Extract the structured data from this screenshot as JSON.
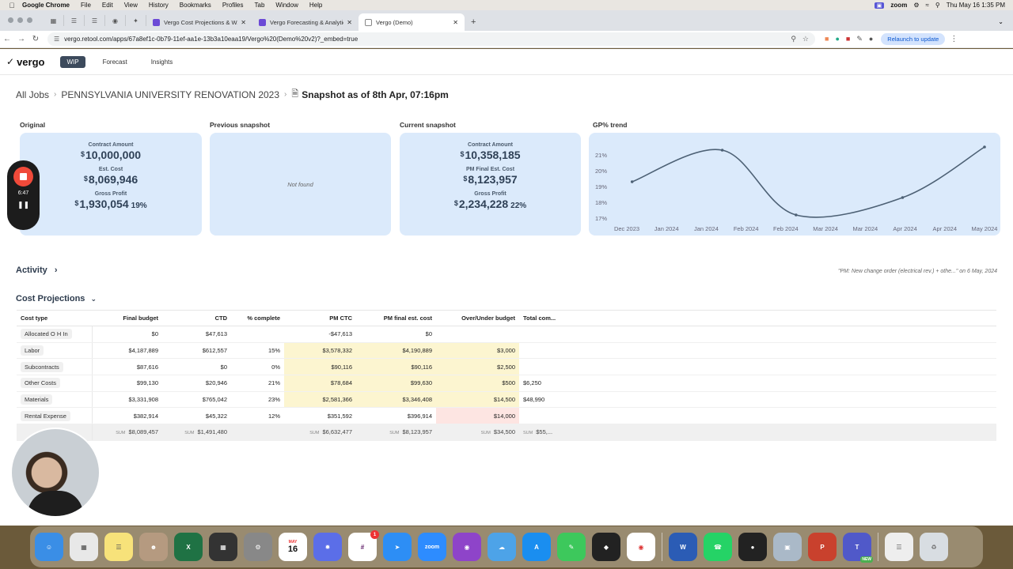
{
  "menubar": {
    "app": "Google Chrome",
    "items": [
      "File",
      "Edit",
      "View",
      "History",
      "Bookmarks",
      "Profiles",
      "Tab",
      "Window",
      "Help"
    ],
    "zoom": "zoom",
    "datetime": "Thu May 16  1:35 PM"
  },
  "tabs": [
    {
      "title": "Vergo Cost Projections & W...",
      "active": false
    },
    {
      "title": "Vergo Forecasting & Analytic...",
      "active": false
    },
    {
      "title": "Vergo (Demo)",
      "active": true
    }
  ],
  "address": {
    "url": "vergo.retool.com/apps/67a8ef1c-0b79-11ef-aa1e-13b3a10eaa19/Vergo%20(Demo%20v2)?_embed=true",
    "relaunch": "Relaunch to update"
  },
  "app": {
    "logo": "vergo",
    "nav": [
      "WIP",
      "Forecast",
      "Insights"
    ]
  },
  "breadcrumb": {
    "all_jobs": "All Jobs",
    "job": "PENNSYLVANIA UNIVERSITY RENOVATION 2023",
    "snapshot": "Snapshot as of 8th Apr, 07:16pm"
  },
  "original": {
    "title": "Original",
    "contract_label": "Contract Amount",
    "contract_value": "10,000,000",
    "cost_label": "Est. Cost",
    "cost_value": "8,069,946",
    "gp_label": "Gross Profit",
    "gp_value": "1,930,054",
    "gp_pct": "19%"
  },
  "previous": {
    "title": "Previous snapshot",
    "empty": "Not found"
  },
  "current": {
    "title": "Current snapshot",
    "contract_label": "Contract Amount",
    "contract_value": "10,358,185",
    "cost_label": "PM Final Est. Cost",
    "cost_value": "8,123,957",
    "gp_label": "Gross Profit",
    "gp_value": "2,234,228",
    "gp_pct": "22%"
  },
  "currency_symbol": "$",
  "chart_data": {
    "type": "line",
    "title": "GP% trend",
    "x_tick_labels": [
      "Dec 2023",
      "Jan 2024",
      "Jan 2024",
      "Feb 2024",
      "Feb 2024",
      "Mar 2024",
      "Mar 2024",
      "Apr 2024",
      "Apr 2024",
      "May 2024"
    ],
    "y_tick_labels": [
      "21%",
      "20%",
      "19%",
      "18%",
      "17%"
    ],
    "ylim": [
      16.8,
      21.7
    ],
    "xlim": [
      0,
      9
    ],
    "points": [
      {
        "x": 0.4,
        "y": 19.3
      },
      {
        "x": 2.6,
        "y": 21.3
      },
      {
        "x": 4.4,
        "y": 17.2
      },
      {
        "x": 7.0,
        "y": 18.3
      },
      {
        "x": 9.0,
        "y": 21.5
      }
    ],
    "color": "#4d6175"
  },
  "activity": {
    "title": "Activity",
    "note": "\"PM: New change order (electrical rev.) + othe...\" on 6 May, 2024"
  },
  "cost_projections": {
    "title": "Cost Projections",
    "columns": [
      "Cost type",
      "Final budget",
      "CTD",
      "% complete",
      "PM CTC",
      "PM final est. cost",
      "Over/Under budget",
      "Total com..."
    ],
    "rows": [
      {
        "type": "Allocated O H In",
        "final_budget": "$0",
        "ctd": "$47,613",
        "pct": "",
        "ctc": "-$47,613",
        "final_est": "$0",
        "over_under": "",
        "total": "",
        "hl": "none",
        "ou_hl": "none"
      },
      {
        "type": "Labor",
        "final_budget": "$4,187,889",
        "ctd": "$612,557",
        "pct": "15%",
        "ctc": "$3,578,332",
        "final_est": "$4,190,889",
        "over_under": "$3,000",
        "total": "",
        "hl": "yellow",
        "ou_hl": "yellow"
      },
      {
        "type": "Subcontracts",
        "final_budget": "$87,616",
        "ctd": "$0",
        "pct": "0%",
        "ctc": "$90,116",
        "final_est": "$90,116",
        "over_under": "$2,500",
        "total": "",
        "hl": "yellow",
        "ou_hl": "yellow"
      },
      {
        "type": "Other Costs",
        "final_budget": "$99,130",
        "ctd": "$20,946",
        "pct": "21%",
        "ctc": "$78,684",
        "final_est": "$99,630",
        "over_under": "$500",
        "total": "$6,250",
        "hl": "yellow",
        "ou_hl": "yellow"
      },
      {
        "type": "Materials",
        "final_budget": "$3,331,908",
        "ctd": "$765,042",
        "pct": "23%",
        "ctc": "$2,581,366",
        "final_est": "$3,346,408",
        "over_under": "$14,500",
        "total": "$48,990",
        "hl": "yellow",
        "ou_hl": "yellow"
      },
      {
        "type": "Rental Expense",
        "final_budget": "$382,914",
        "ctd": "$45,322",
        "pct": "12%",
        "ctc": "$351,592",
        "final_est": "$396,914",
        "over_under": "$14,000",
        "total": "",
        "hl": "none",
        "ou_hl": "pink"
      }
    ],
    "sum_label": "SUM",
    "sums": {
      "final_budget": "$8,089,457",
      "ctd": "$1,491,480",
      "ctc": "$6,632,477",
      "final_est": "$8,123,957",
      "over_under": "$34,500",
      "total": "$55,..."
    }
  },
  "recorder": {
    "time": "6:47"
  },
  "dock_items": [
    "Finder",
    "Launchpad",
    "Notes",
    "Contacts",
    "Excel",
    "Calculator",
    "System Settings",
    "Calendar",
    "Perplexity",
    "Slack",
    "Safari",
    "Zoom",
    "Podcasts",
    "Preview",
    "App Store",
    "Messages",
    "Screens",
    "Chrome",
    "Word",
    "WhatsApp",
    "Figma",
    "Photos",
    "PowerPoint",
    "Teams",
    "Document",
    "Trash"
  ],
  "calendar": {
    "month": "MAY",
    "day": "16"
  },
  "slack_badge": "1",
  "teams_badge": "NEW"
}
